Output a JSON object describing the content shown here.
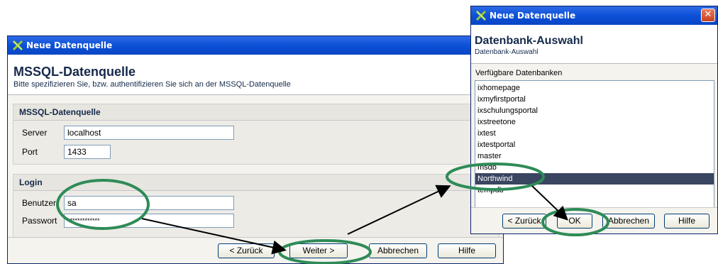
{
  "main_dialog": {
    "title": "Neue Datenquelle",
    "heading": "MSSQL-Datenquelle",
    "subheading": "Bitte spezifizieren Sie, bzw. authentifizieren Sie sich an der MSSQL-Datenquelle",
    "connection_group": {
      "title": "MSSQL-Datenquelle",
      "server_label": "Server",
      "server_value": "localhost",
      "port_label": "Port",
      "port_value": "1433"
    },
    "login_group": {
      "title": "Login",
      "user_label": "Benutzer",
      "user_value": "sa",
      "password_label": "Passwort",
      "password_value": "*************"
    },
    "buttons": {
      "back": "< Zurück",
      "next": "Weiter >",
      "cancel": "Abbrechen",
      "help": "Hilfe"
    }
  },
  "db_dialog": {
    "title": "Neue Datenquelle",
    "close_glyph": "✕",
    "heading": "Datenbank-Auswahl",
    "subheading": "Datenbank-Auswahl",
    "list_label": "Verfügbare Datenbanken",
    "databases": [
      "ixhomepage",
      "ixmyfirstportal",
      "ixschulungsportal",
      "ixstreetone",
      "ixtest",
      "ixtestportal",
      "master",
      "msdb",
      "Northwind",
      "tempdb"
    ],
    "selected_index": 8,
    "buttons": {
      "back": "< Zurück",
      "ok": "OK",
      "cancel": "Abbrechen",
      "help": "Hilfe"
    }
  },
  "colors": {
    "highlight_ellipse": "#2e8b57",
    "title_bar": "#0a4fd6",
    "selection": "#3a4560"
  },
  "icons": {
    "app": "x-logo-icon",
    "close": "close-icon"
  }
}
